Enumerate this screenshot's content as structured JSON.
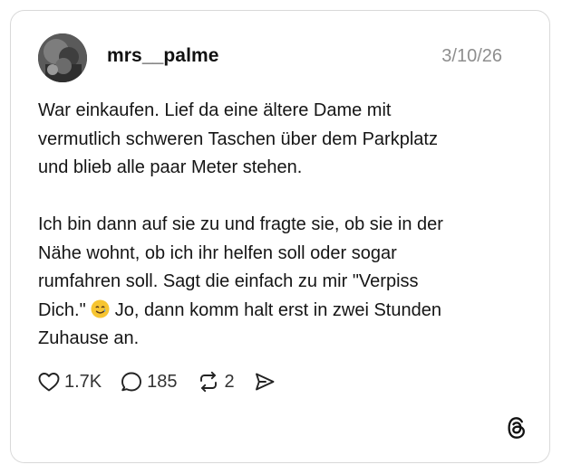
{
  "post": {
    "username": "mrs__palme",
    "date": "3/10/26",
    "text_part1": "War einkaufen. Lief da eine ältere Dame mit\nvermutlich schweren Taschen über dem Parkplatz\nund blieb alle paar Meter stehen.\n\nIch bin dann auf sie zu und fragte sie, ob sie in der\nNähe wohnt, ob ich ihr helfen soll oder sogar\nrumfahren soll. Sagt die einfach zu mir \"Verpiss\nDich.\" ",
    "text_part2": " Jo, dann komm halt erst in zwei Stunden\nZuhause an.",
    "emoji": "smiling-face-with-tear"
  },
  "actions": {
    "likes": "1.7K",
    "replies": "185",
    "reposts": "2"
  },
  "icons": {
    "like": "heart-icon",
    "reply": "speech-bubble-icon",
    "repost": "repost-icon",
    "share": "send-icon",
    "brand": "threads-logo-icon"
  },
  "colors": {
    "text": "#151515",
    "muted": "#8e8e8e",
    "border": "#d9d9d9",
    "emoji": "#f7c531"
  }
}
